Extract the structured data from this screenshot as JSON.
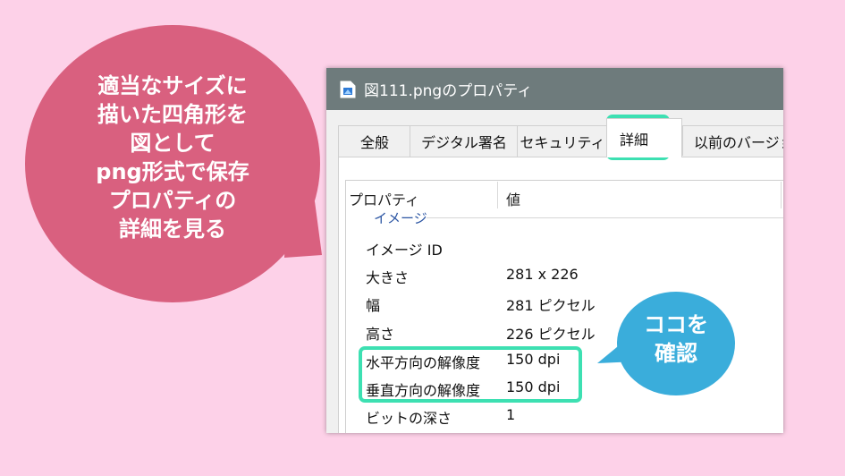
{
  "callout_left": {
    "lines": [
      "適当なサイズに",
      "描いた四角形を",
      "図として",
      "png形式で保存",
      "プロパティの",
      "詳細を見る"
    ],
    "color": "#d9607f"
  },
  "window": {
    "title": "図111.pngのプロパティ",
    "title_icon": "image-file-icon"
  },
  "tabs": [
    {
      "label": "全般"
    },
    {
      "label": "デジタル署名"
    },
    {
      "label": "セキュリティ"
    },
    {
      "label": "詳細",
      "selected": true
    },
    {
      "label": "以前のバージョ"
    }
  ],
  "details": {
    "col_property": "プロパティ",
    "col_value": "値",
    "group": "イメージ",
    "rows": [
      {
        "name": "イメージ ID",
        "value": ""
      },
      {
        "name": "大きさ",
        "value": "281 x 226"
      },
      {
        "name": "幅",
        "value": "281 ピクセル"
      },
      {
        "name": "高さ",
        "value": "226 ピクセル"
      },
      {
        "name": "水平方向の解像度",
        "value": "150 dpi"
      },
      {
        "name": "垂直方向の解像度",
        "value": "150 dpi"
      },
      {
        "name": "ビットの深さ",
        "value": "1"
      }
    ]
  },
  "callout_right": {
    "lines": [
      "ココを",
      "確認"
    ],
    "color": "#3aaddb"
  },
  "highlight_color": "#3de0b2"
}
